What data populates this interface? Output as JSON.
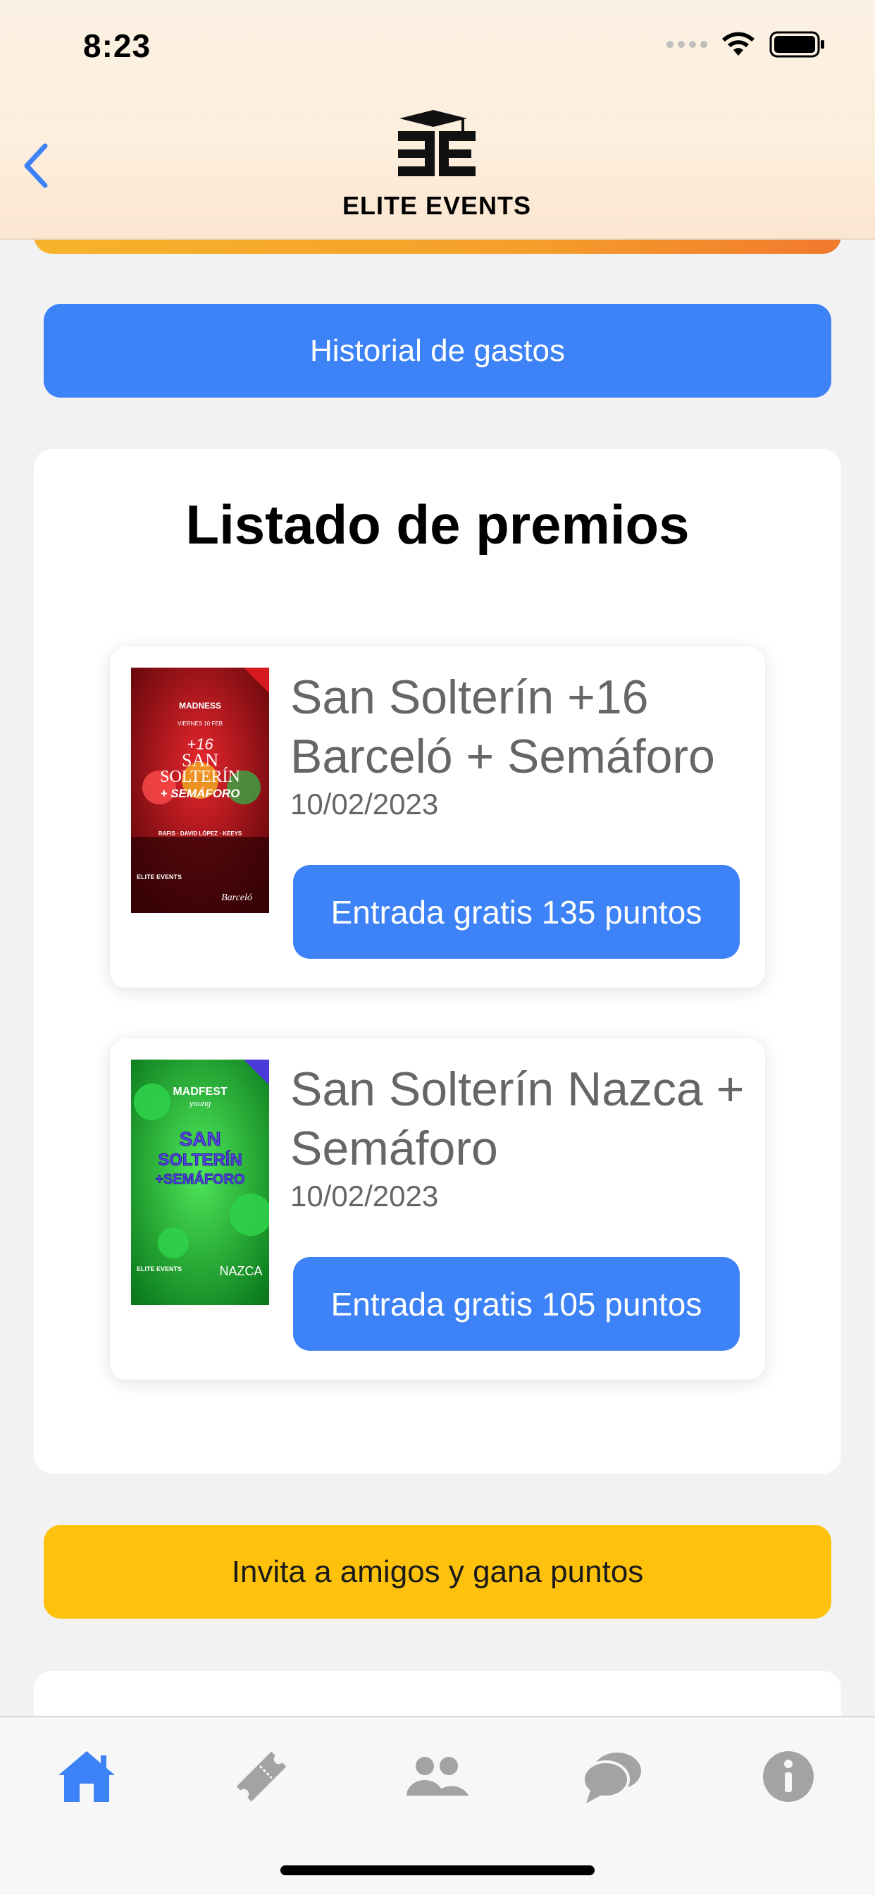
{
  "status_bar": {
    "time": "8:23"
  },
  "header": {
    "brand": "ELITE EVENTS"
  },
  "history_button": {
    "label": "Historial de gastos"
  },
  "prizes": {
    "title": "Listado de premios",
    "items": [
      {
        "name": "San Solterín +16 Barceló + Semáforo",
        "date": "10/02/2023",
        "button": "Entrada gratis 135 puntos",
        "poster": {
          "top": "MADNESS",
          "sub": "VIERNES 10 FEB",
          "big1": "+16",
          "big2": "SAN",
          "big3": "SOLTERÍN",
          "big4": "+ SEMÁFORO",
          "line": "RAFIS · DAVID LÓPEZ · KEEYS",
          "brand": "ELITE EVENTS",
          "venue": "Barceló"
        }
      },
      {
        "name": "San Solterín Nazca + Semáforo",
        "date": "10/02/2023",
        "button": "Entrada gratis 105 puntos",
        "poster": {
          "top": "MADFEST",
          "sub": "young",
          "big1": "SAN",
          "big2": "SOLTERÍN",
          "big3": "+SEMÁFORO",
          "brand": "ELITE EVENTS",
          "venue": "NAZCA"
        }
      }
    ]
  },
  "invite_button": {
    "label": "Invita a amigos y gana puntos"
  },
  "tabbar": {
    "items": [
      "home-icon",
      "ticket-icon",
      "users-icon",
      "chat-icon",
      "info-icon"
    ],
    "active_color": "#3d82f7",
    "inactive_color": "#a3a3a3"
  },
  "colors": {
    "accent": "#3d82f7",
    "invite": "#fec20c"
  }
}
